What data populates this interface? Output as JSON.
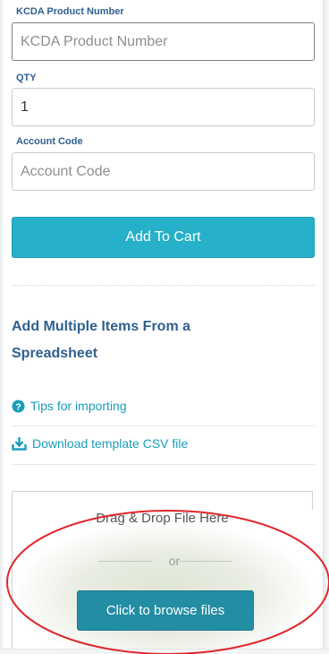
{
  "form": {
    "product_label": "KCDA Product Number",
    "product_placeholder": "KCDA Product Number",
    "qty_label": "QTY",
    "qty_value": "1",
    "account_label": "Account Code",
    "account_placeholder": "Account Code",
    "add_button": "Add To Cart"
  },
  "spreadsheet": {
    "title": "Add Multiple Items From a Spreadsheet",
    "tips_link": "Tips for importing",
    "tips_icon": "help-circle-icon",
    "download_link": "Download template CSV file",
    "download_icon": "download-icon"
  },
  "dropzone": {
    "text": "Drag & Drop File Here",
    "or": "or",
    "browse_button": "Click to browse files"
  },
  "colors": {
    "accent": "#26b0c9",
    "label": "#2f5f8f",
    "link": "#1a9dbb",
    "annotation": "#e0262b"
  }
}
